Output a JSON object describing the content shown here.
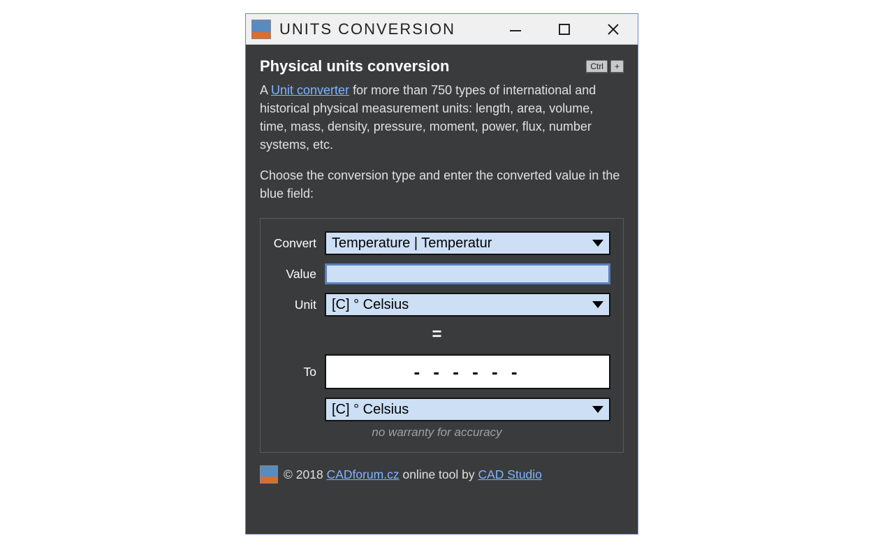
{
  "titlebar": {
    "title": "UNITS CONVERSION"
  },
  "header": {
    "title": "Physical units conversion",
    "kbd1": "Ctrl",
    "kbd2": "+"
  },
  "intro": {
    "prefix": "A ",
    "link_text": "Unit converter",
    "rest": " for more than 750 types of international and historical physical measurement units: length, area, volume, time, mass, density, pressure, moment, power, flux, number systems, etc.",
    "line2": "Choose the conversion type and enter the converted value in the blue field:"
  },
  "form": {
    "convert_label": "Convert",
    "convert_value": "Temperature | Temperatur",
    "value_label": "Value",
    "value_value": "",
    "unit_label": "Unit",
    "unit_value": "[C] ° Celsius",
    "equals": "=",
    "to_label": "To",
    "result": "- - - - - -",
    "to_unit_value": "[C] ° Celsius",
    "disclaimer": "no warranty for accuracy"
  },
  "footer": {
    "copyright": "© 2018 ",
    "link1": "CADforum.cz",
    "middle": " online tool by ",
    "link2": "CAD Studio"
  }
}
